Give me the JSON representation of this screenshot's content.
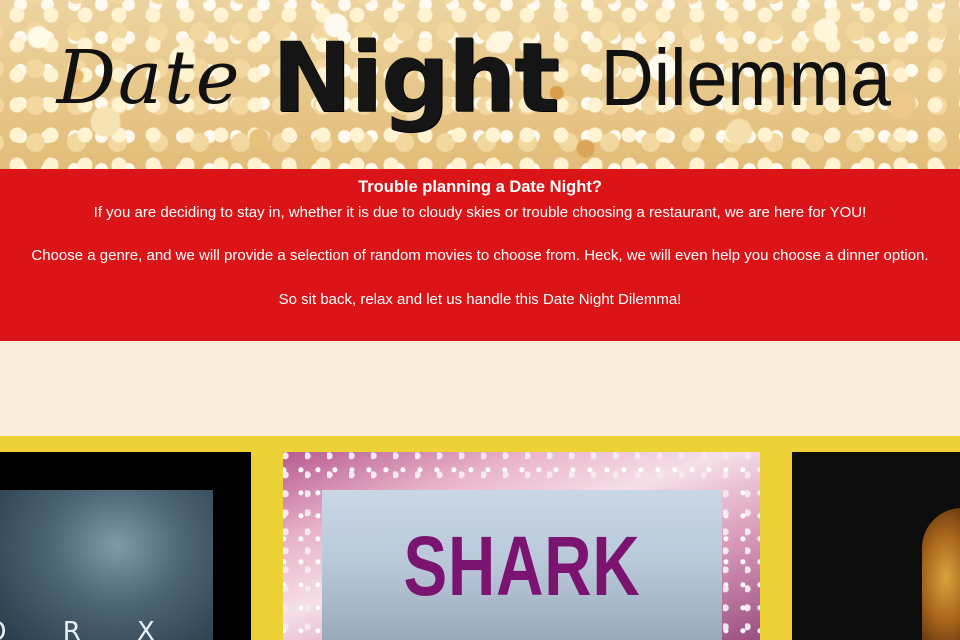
{
  "header": {
    "title_part1": "Date",
    "title_part2": "Night",
    "title_part3": "Dilemma"
  },
  "intro": {
    "heading": "Trouble planning a Date Night?",
    "line1": "If you are deciding to stay in, whether it is due to cloudy skies or trouble choosing a restaurant, we are here for YOU!",
    "line2": "Choose a genre, and we will provide a selection of random movies to choose from. Heck, we will even help you choose a dinner option.",
    "line3": "So sit back, relax and let us handle this Date Night Dilemma!"
  },
  "movies": [
    {
      "poster_text": "O R X"
    },
    {
      "poster_text": "SHARK"
    },
    {
      "poster_text": ""
    }
  ],
  "colors": {
    "intro_band": "#db1417",
    "page_background": "#f9ecd9",
    "movie_strip": "#ecd137"
  }
}
